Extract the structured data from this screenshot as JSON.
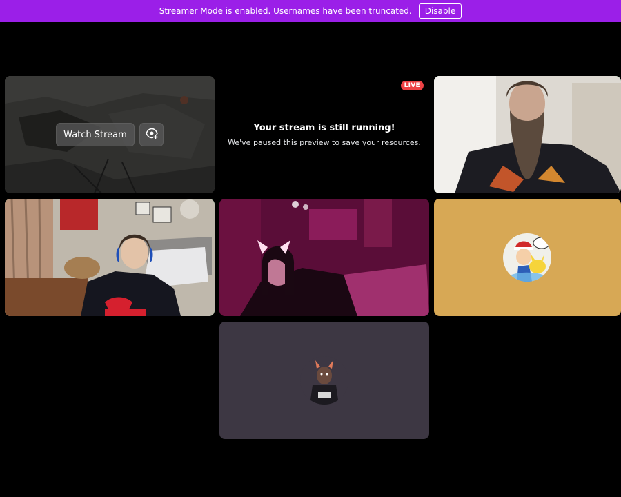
{
  "banner": {
    "message": "Streamer Mode is enabled. Usernames have been truncated.",
    "disable_label": "Disable",
    "color": "#9b1fe8"
  },
  "stream_preview": {
    "watch_label": "Watch Stream",
    "preview_icon": "eye-plus-icon"
  },
  "paused_stream": {
    "badge": "LIVE",
    "title": "Your stream is still running!",
    "subtitle": "We've paused this preview to save your resources."
  },
  "tiles": [
    {
      "kind": "stream-preview"
    },
    {
      "kind": "paused-stream"
    },
    {
      "kind": "camera",
      "speaking": true
    },
    {
      "kind": "camera",
      "speaking": true
    },
    {
      "kind": "camera",
      "speaking": false
    },
    {
      "kind": "avatar",
      "background": "#d7a855"
    },
    {
      "kind": "avatar",
      "background": "#3d3743"
    }
  ],
  "colors": {
    "speaking_ring": "#2dc770",
    "live_badge": "#ed4245",
    "background": "#000000"
  }
}
